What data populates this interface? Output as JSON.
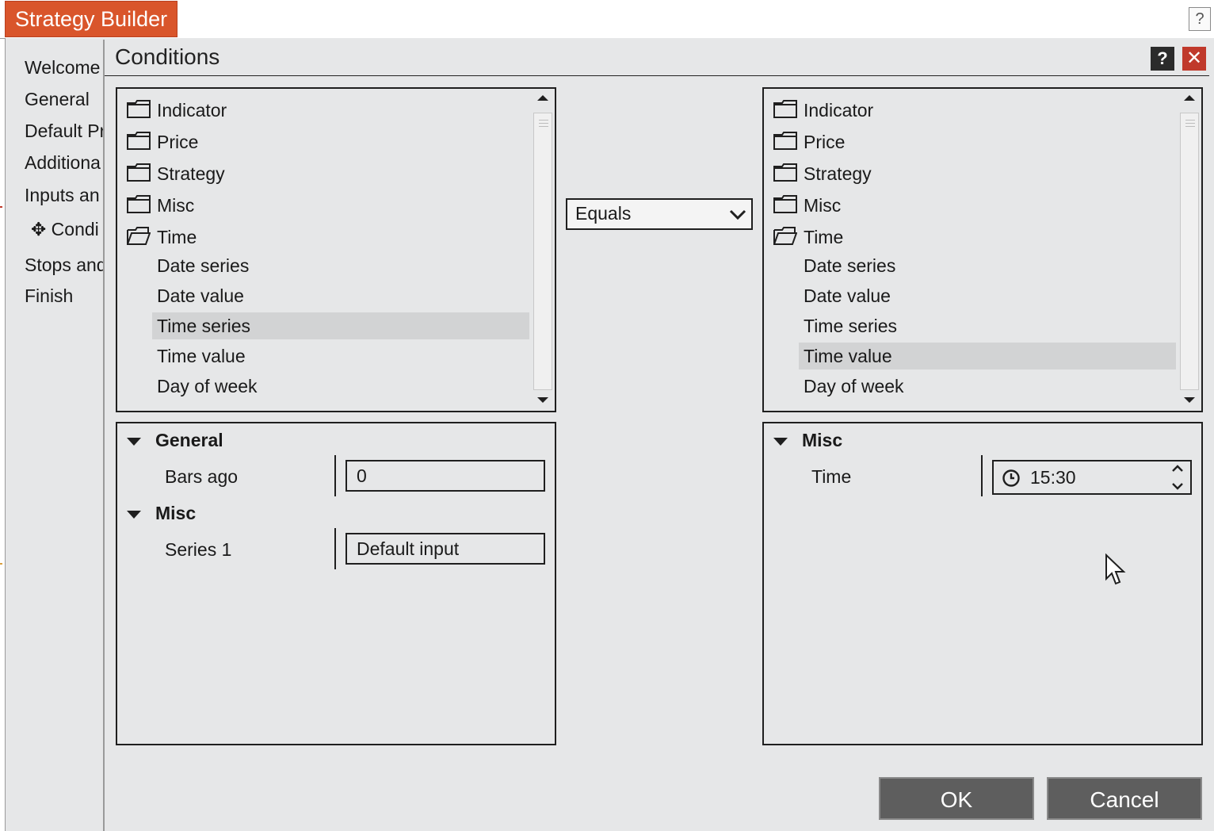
{
  "window": {
    "title": "Strategy Builder",
    "help_glyph": "?",
    "accent_color": "#d9552b"
  },
  "nav": {
    "items": [
      {
        "label": "Welcome"
      },
      {
        "label": "General"
      },
      {
        "label": "Default Pr"
      },
      {
        "label": "Additiona"
      },
      {
        "label": "Inputs an"
      },
      {
        "label": "✥ Condi"
      },
      {
        "label": "Stops and"
      },
      {
        "label": "Finish"
      }
    ]
  },
  "dialog": {
    "title": "Conditions",
    "help_glyph": "?",
    "close_glyph": "✕",
    "left": {
      "tree": {
        "folders": [
          {
            "label": "Indicator",
            "icon": "folder-icon"
          },
          {
            "label": "Price",
            "icon": "folder-icon"
          },
          {
            "label": "Strategy",
            "icon": "folder-icon"
          },
          {
            "label": "Misc",
            "icon": "folder-icon"
          },
          {
            "label": "Time",
            "icon": "folder-open-icon"
          }
        ],
        "children": [
          {
            "label": "Date series",
            "selected": false
          },
          {
            "label": "Date value",
            "selected": false
          },
          {
            "label": "Time series",
            "selected": true
          },
          {
            "label": "Time value",
            "selected": false
          },
          {
            "label": "Day of week",
            "selected": false
          }
        ]
      },
      "properties": {
        "general_header": "General",
        "bars_ago_label": "Bars ago",
        "bars_ago_value": "0",
        "misc_header": "Misc",
        "series_label": "Series 1",
        "series_value": "Default input"
      }
    },
    "operator": {
      "selected": "Equals"
    },
    "right": {
      "tree": {
        "folders": [
          {
            "label": "Indicator",
            "icon": "folder-icon"
          },
          {
            "label": "Price",
            "icon": "folder-icon"
          },
          {
            "label": "Strategy",
            "icon": "folder-icon"
          },
          {
            "label": "Misc",
            "icon": "folder-icon"
          },
          {
            "label": "Time",
            "icon": "folder-open-icon"
          }
        ],
        "children": [
          {
            "label": "Date series",
            "selected": false
          },
          {
            "label": "Date value",
            "selected": false
          },
          {
            "label": "Time series",
            "selected": false
          },
          {
            "label": "Time value",
            "selected": true
          },
          {
            "label": "Day of week",
            "selected": false
          }
        ]
      },
      "properties": {
        "misc_header": "Misc",
        "time_label": "Time",
        "time_value": "15:30",
        "time_icon": "clock-icon"
      }
    },
    "buttons": {
      "ok": "OK",
      "cancel": "Cancel"
    }
  }
}
